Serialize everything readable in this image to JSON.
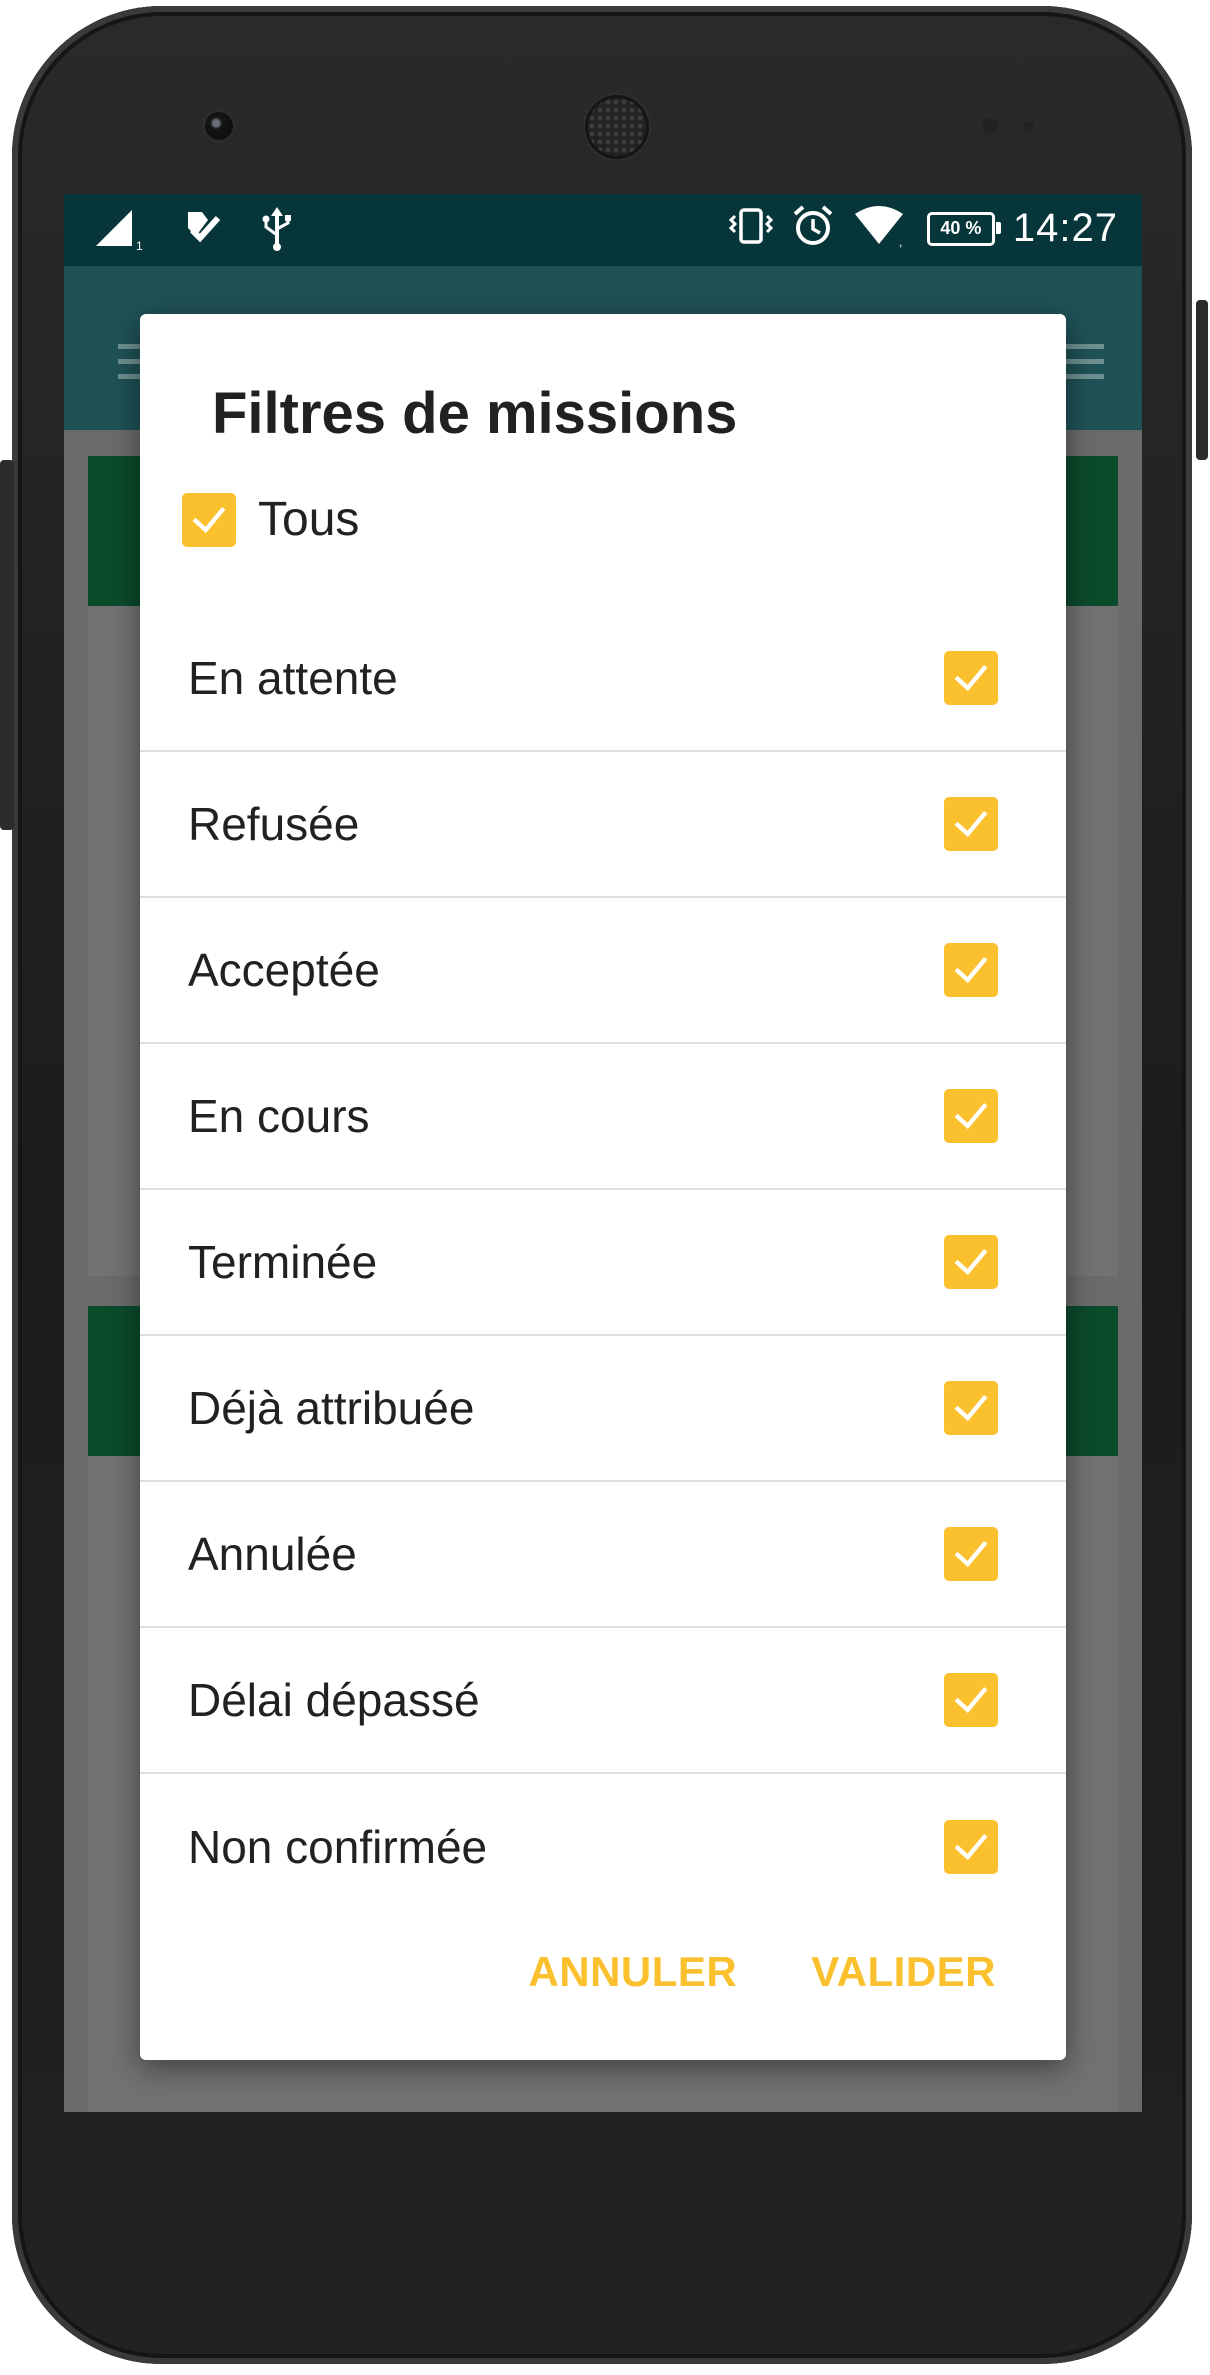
{
  "status_bar": {
    "time": "14:27",
    "battery_percent": "40 %",
    "icons": [
      "signal-icon",
      "task-check-icon",
      "usb-icon",
      "vibrate-icon",
      "alarm-icon",
      "wifi-icon",
      "battery-icon"
    ]
  },
  "dialog": {
    "title": "Filtres de missions",
    "select_all": {
      "label": "Tous",
      "checked": true
    },
    "items": [
      {
        "label": "En attente",
        "checked": true
      },
      {
        "label": "Refusée",
        "checked": true
      },
      {
        "label": "Acceptée",
        "checked": true
      },
      {
        "label": "En cours",
        "checked": true
      },
      {
        "label": "Terminée",
        "checked": true
      },
      {
        "label": "Déjà attribuée",
        "checked": true
      },
      {
        "label": "Annulée",
        "checked": true
      },
      {
        "label": "Délai dépassé",
        "checked": true
      },
      {
        "label": "Non confirmée",
        "checked": true
      }
    ],
    "cancel_label": "ANNULER",
    "confirm_label": "VALIDER"
  },
  "colors": {
    "accent": "#fbc02d",
    "status_bar": "#06353a",
    "toolbar_dimmed": "#1f5256",
    "card_header_dimmed": "#0b4b2c"
  }
}
